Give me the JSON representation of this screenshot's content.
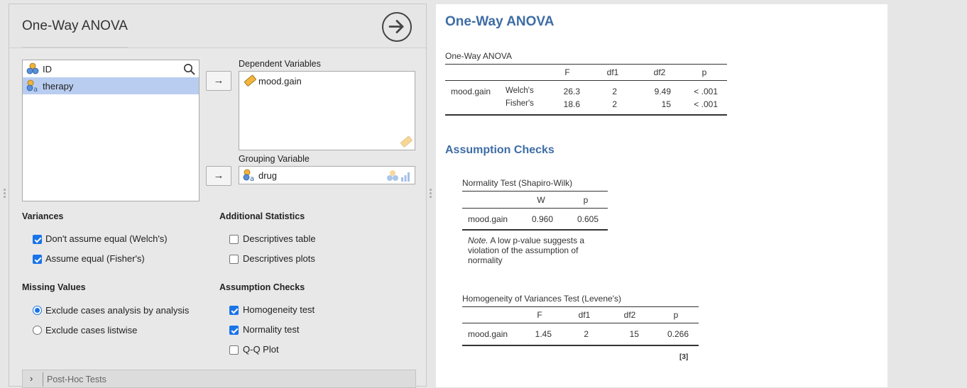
{
  "options": {
    "title": "One-Way ANOVA",
    "variables": [
      {
        "label": "ID",
        "icon": "nominal-integer-icon"
      },
      {
        "label": "therapy",
        "icon": "nominal-text-icon"
      }
    ],
    "dependent": {
      "label": "Dependent Variables",
      "items": [
        "mood.gain"
      ]
    },
    "grouping": {
      "label": "Grouping Variable",
      "value": "drug"
    },
    "arrow": "→",
    "variances": {
      "title": "Variances",
      "items": [
        {
          "label": "Don't assume equal (Welch's)",
          "checked": true
        },
        {
          "label": "Assume equal (Fisher's)",
          "checked": true
        }
      ]
    },
    "additional": {
      "title": "Additional Statistics",
      "items": [
        {
          "label": "Descriptives table",
          "checked": false
        },
        {
          "label": "Descriptives plots",
          "checked": false
        }
      ]
    },
    "missing": {
      "title": "Missing Values",
      "items": [
        {
          "label": "Exclude cases analysis by analysis",
          "selected": true
        },
        {
          "label": "Exclude cases listwise",
          "selected": false
        }
      ]
    },
    "assumption": {
      "title": "Assumption Checks",
      "items": [
        {
          "label": "Homogeneity test",
          "checked": true
        },
        {
          "label": "Normality test",
          "checked": true
        },
        {
          "label": "Q-Q Plot",
          "checked": false
        }
      ]
    },
    "posthoc": {
      "label": "Post-Hoc Tests",
      "chevron": "›"
    }
  },
  "results": {
    "heading": "One-Way ANOVA",
    "anova": {
      "title": "One-Way ANOVA",
      "columns": [
        "F",
        "df1",
        "df2",
        "p"
      ],
      "rows": [
        {
          "var": "mood.gain",
          "test": "Welch's",
          "F": "26.3",
          "df1": "2",
          "df2": "9.49",
          "p": "< .001"
        },
        {
          "var": "",
          "test": "Fisher's",
          "F": "18.6",
          "df1": "2",
          "df2": "15",
          "p": "< .001"
        }
      ]
    },
    "assumption_heading": "Assumption Checks",
    "normality": {
      "title": "Normality Test (Shapiro-Wilk)",
      "columns": [
        "W",
        "p"
      ],
      "row": {
        "var": "mood.gain",
        "W": "0.960",
        "p": "0.605"
      },
      "note_label": "Note.",
      "note_text": " A low p-value suggests a violation of the assumption of normality"
    },
    "levene": {
      "title": "Homogeneity of Variances Test (Levene's)",
      "columns": [
        "F",
        "df1",
        "df2",
        "p"
      ],
      "row": {
        "var": "mood.gain",
        "F": "1.45",
        "df1": "2",
        "df2": "15",
        "p": "0.266"
      }
    },
    "reference": "[3]"
  },
  "colors": {
    "heading": "#3e6da5",
    "selection": "#b9cdf0",
    "checkbox": "#1a73e8"
  }
}
